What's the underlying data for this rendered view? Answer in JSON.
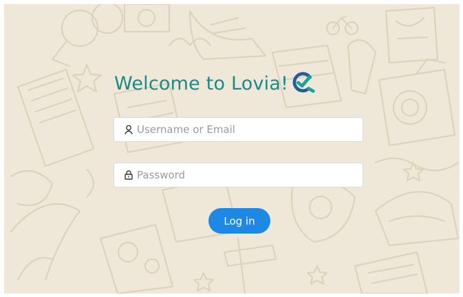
{
  "login": {
    "title": "Welcome to Lovia!",
    "logo_icon": "lovia-check-logo-icon",
    "username_placeholder": "Username or Email",
    "username_value": "",
    "username_icon": "user-icon",
    "password_placeholder": "Password",
    "password_value": "",
    "password_icon": "lock-icon",
    "submit_label": "Log in"
  },
  "colors": {
    "background": "#efe8d8",
    "pattern": "#ddd3bd",
    "title": "#1a8a88",
    "button": "#1e88e5",
    "logo_dark": "#1f5f9a",
    "logo_teal": "#1aa39a"
  }
}
